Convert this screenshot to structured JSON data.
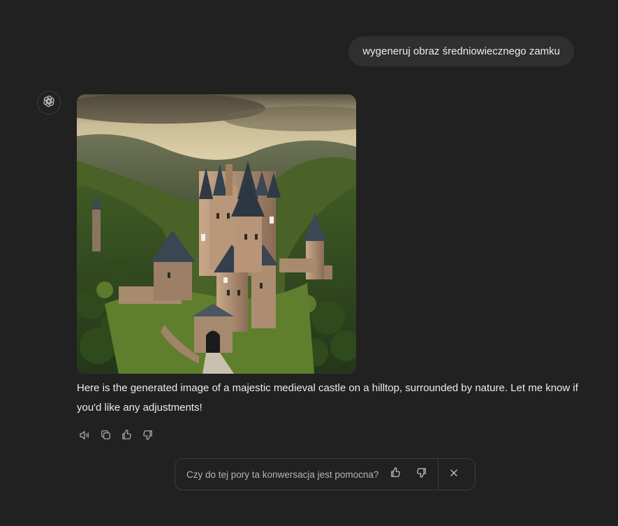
{
  "user_message": "wygeneruj obraz średniowiecznego zamku",
  "assistant": {
    "avatar_icon": "openai-logo-icon",
    "image_alt": "medieval castle on a hilltop",
    "response_text": "Here is the generated image of a majestic medieval castle on a hilltop, surrounded by nature. Let me know if you'd like any adjustments!",
    "actions": [
      "speaker-icon",
      "copy-icon",
      "thumbs-up-icon",
      "thumbs-down-icon"
    ]
  },
  "feedback_prompt": {
    "text": "Czy do tej pory ta konwersacja jest pomocna?",
    "icons": [
      "thumbs-up-icon",
      "thumbs-down-icon",
      "close-icon"
    ]
  },
  "colors": {
    "background": "#212121",
    "bubble": "#2f2f2f",
    "text": "#ececec",
    "muted": "#b4b4b4"
  }
}
